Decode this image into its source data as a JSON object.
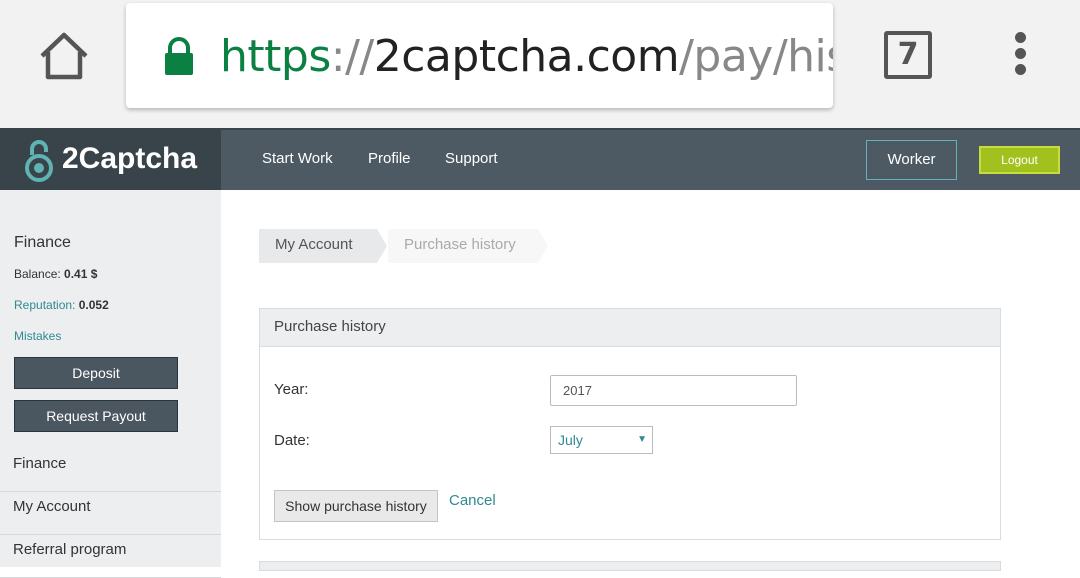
{
  "browser": {
    "url_scheme": "https",
    "url_sep": "://",
    "url_host": "2captcha.com",
    "url_path": "/pay/histc",
    "tab_count": "7",
    "home_icon": "home-icon",
    "lock_icon": "lock-icon",
    "menu_icon": "more-vert-icon"
  },
  "header": {
    "brand": "2Captcha",
    "nav": [
      "Start Work",
      "Profile",
      "Support"
    ],
    "worker_label": "Worker",
    "logout_label": "Logout",
    "accent": "#a3c11e"
  },
  "sidebar": {
    "heading": "Finance",
    "balance_label": "Balance:",
    "balance_value": "0.41 $",
    "reputation_label": "Reputation:",
    "reputation_value": "0.052",
    "mistakes_label": "Mistakes",
    "deposit_label": "Deposit",
    "payout_label": "Request Payout",
    "menu": [
      "Finance",
      "My Account",
      "Referral program"
    ]
  },
  "breadcrumb": [
    "My Account",
    "Purchase history"
  ],
  "form": {
    "title": "Purchase history",
    "year_label": "Year:",
    "year_value": "2017",
    "date_label": "Date:",
    "date_value": "July",
    "show_label": "Show purchase history",
    "cancel_label": "Cancel"
  }
}
